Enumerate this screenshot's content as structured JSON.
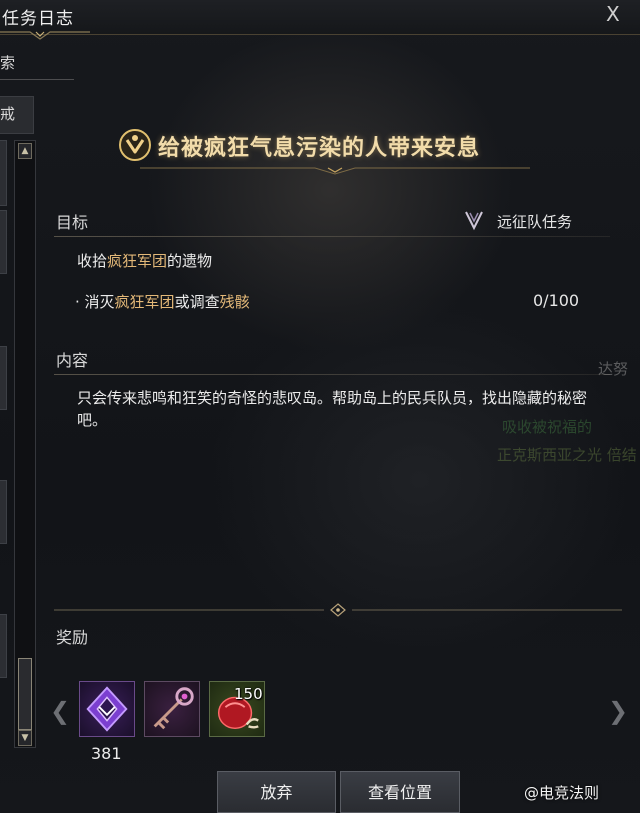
{
  "window": {
    "title": "任务日志",
    "close_label": "X"
  },
  "left": {
    "search_fragment": "索",
    "tab_fragment": "戒",
    "scroll_up": "▲",
    "scroll_down": "▼"
  },
  "quest": {
    "name": "给被疯狂气息污染的人带来安息",
    "type_label": "远征队任务",
    "icon": "quest-emblem-icon",
    "type_icon": "expedition-icon"
  },
  "goal": {
    "label": "目标",
    "title_parts": [
      "收拾",
      "疯狂军团",
      "的遗物"
    ],
    "objective_parts": [
      "· 消灭",
      "疯狂军团",
      "或调查",
      "残骸"
    ],
    "progress": "0/100"
  },
  "content": {
    "label": "内容",
    "text": "只会传来悲鸣和狂笑的奇怪的悲叹岛。帮助岛上的民兵队员，找出隐藏的秘密吧。"
  },
  "background_text": {
    "line1": "达努",
    "line2": "吸收被祝福的",
    "line3": "正克斯西亚之光 倍结"
  },
  "rewards": {
    "label": "奖励",
    "items": [
      {
        "icon": "purple-crystal-icon",
        "count": "381"
      },
      {
        "icon": "ornate-key-icon",
        "count": ""
      },
      {
        "icon": "red-seed-icon",
        "count": "150"
      }
    ]
  },
  "buttons": {
    "abandon": "放弃",
    "view_location": "查看位置"
  },
  "watermark": "@电竞法则",
  "colors": {
    "highlight": "#e3b878",
    "title_gold": "#f2dcaa",
    "accent_line": "#8c826e"
  }
}
